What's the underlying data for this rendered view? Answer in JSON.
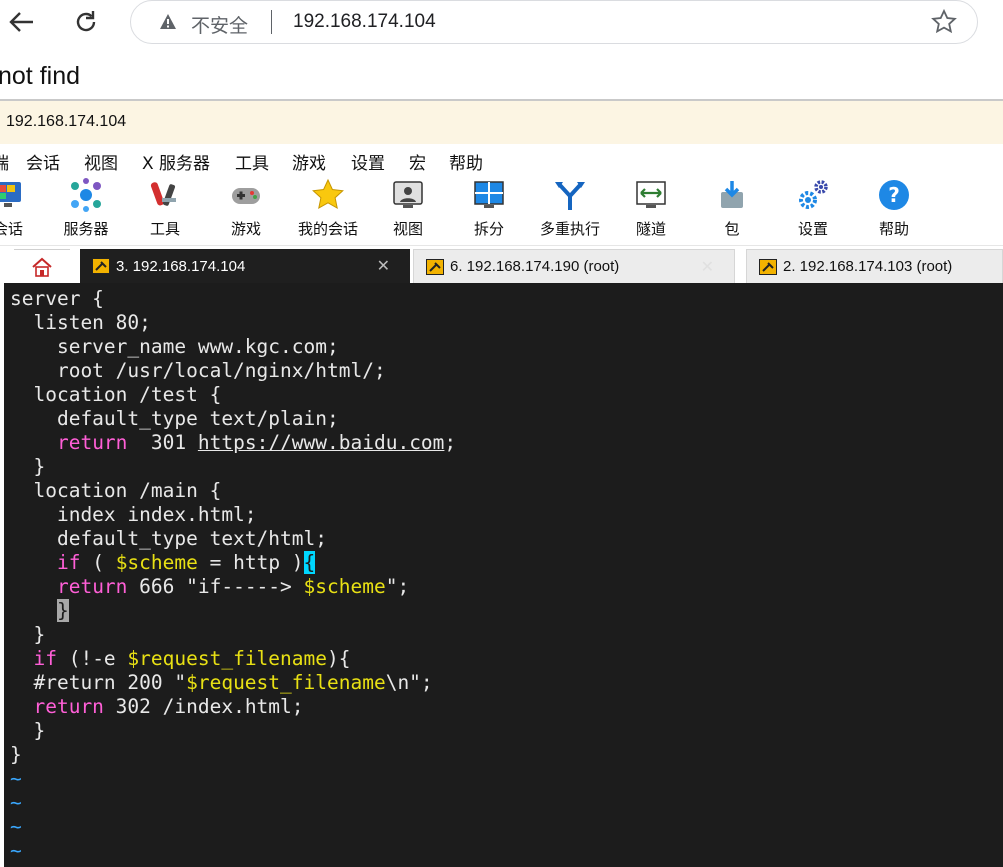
{
  "browser": {
    "insecure_label": "不安全",
    "url": "192.168.174.104"
  },
  "page": {
    "error_text": "not find"
  },
  "app": {
    "title": "192.168.174.104"
  },
  "menu": {
    "items": [
      "端",
      "会话",
      "视图",
      "X 服务器",
      "工具",
      "游戏",
      "设置",
      "宏",
      "帮助"
    ]
  },
  "toolbar": {
    "items": [
      {
        "label": "会话",
        "icon": "sessions-icon"
      },
      {
        "label": "服务器",
        "icon": "servers-icon"
      },
      {
        "label": "工具",
        "icon": "tools-icon"
      },
      {
        "label": "游戏",
        "icon": "games-icon"
      },
      {
        "label": "我的会话",
        "icon": "star-icon"
      },
      {
        "label": "视图",
        "icon": "view-icon"
      },
      {
        "label": "拆分",
        "icon": "split-icon"
      },
      {
        "label": "多重执行",
        "icon": "multiexec-icon"
      },
      {
        "label": "隧道",
        "icon": "tunnel-icon"
      },
      {
        "label": "包",
        "icon": "packages-icon"
      },
      {
        "label": "设置",
        "icon": "settings-icon"
      },
      {
        "label": "帮助",
        "icon": "help-icon"
      }
    ]
  },
  "tabs": [
    {
      "label": "3. 192.168.174.104",
      "active": true
    },
    {
      "label": "6. 192.168.174.190 (root)",
      "active": false
    },
    {
      "label": "2. 192.168.174.103 (root)",
      "active": false
    }
  ],
  "terminal": {
    "lines": [
      "server {",
      "  listen 80;",
      "    server_name www.kgc.com;",
      "    root /usr/local/nginx/html/;",
      "  location /test {",
      "    default_type text/plain;",
      "    return  301 https://www.baidu.com;",
      "  }",
      "  location /main {",
      "    index index.html;",
      "    default_type text/html;",
      "    if ( $scheme = http ){",
      "    return 666 \"if-----> $scheme\";",
      "    }",
      "  }",
      "  if (!-e $request_filename){",
      "  #return 200 \"$request_filename\\n\";",
      "  return 302 /index.html;",
      "  }",
      "}",
      "~",
      "~",
      "~",
      "~"
    ]
  },
  "colors": {
    "terminal_bg": "#1c1c1c",
    "keyword": "#ff5fd7",
    "variable": "#e8e014",
    "tilde": "#3aa8ff",
    "title_bar": "#fcf5e3"
  }
}
